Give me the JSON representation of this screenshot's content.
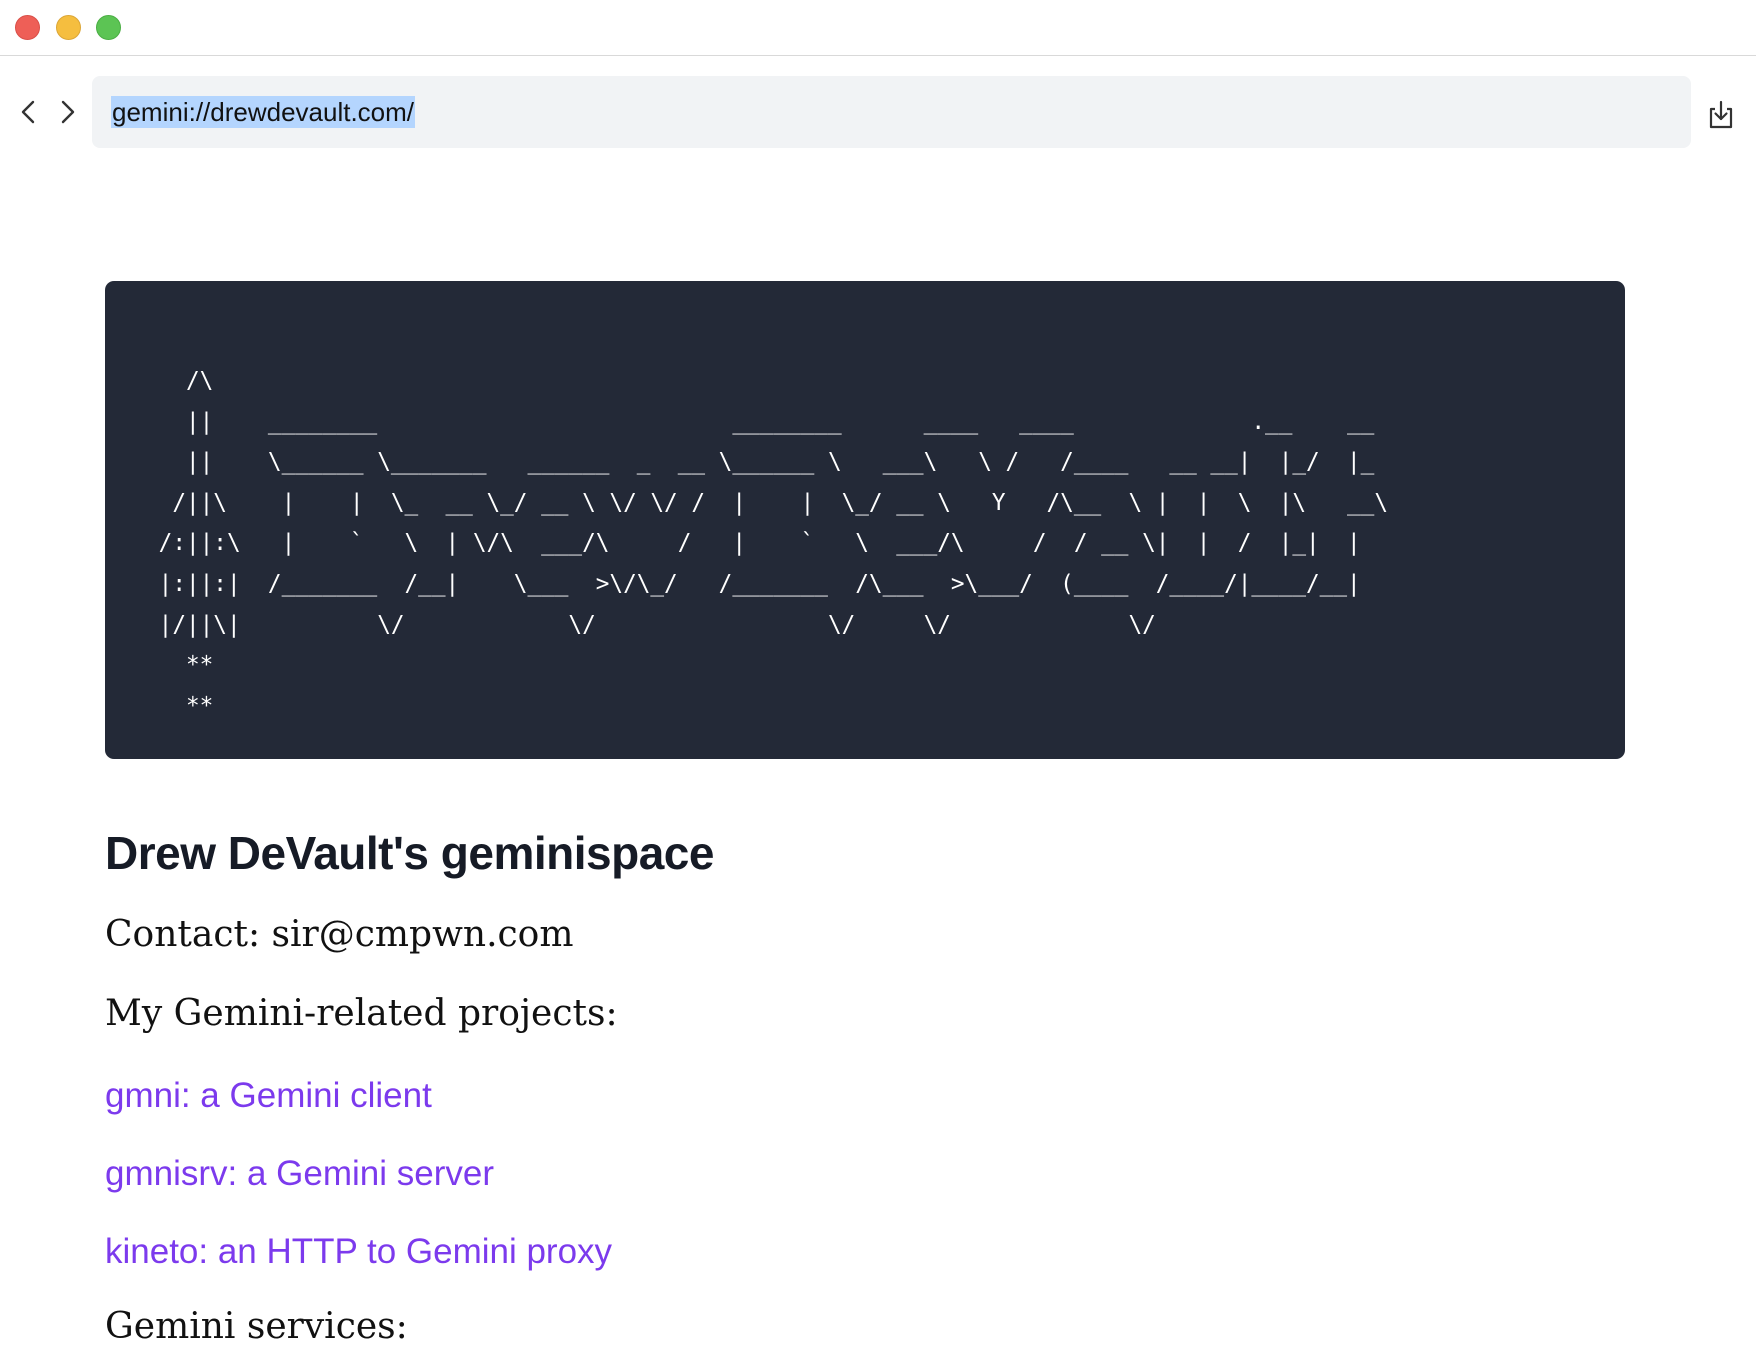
{
  "browser": {
    "url": "gemini://drewdevault.com/",
    "back_icon": "chevron-left-icon",
    "forward_icon": "chevron-right-icon",
    "download_icon": "download-tray-icon"
  },
  "page": {
    "ascii_art": "   /\\\n   ||    ________                          ________      ____   ____             .__    __\n   ||    \\______ \\_______   ______  _  __ \\______ \\   ___\\   \\ /   /____   __ __|  |_/  |_\n  /||\\    |    |  \\_  __ \\_/ __ \\ \\/ \\/ /  |    |  \\_/ __ \\   Y   /\\__  \\ |  |  \\  |\\   __\\\n /:||:\\   |    `   \\  | \\/\\  ___/\\     /   |    `   \\  ___/\\     /  / __ \\|  |  /  |_|  |\n |:||:|  /_______  /__|    \\___  >\\/\\_/   /_______  /\\___  >\\___/  (____  /____/|____/__|\n |/||\\|          \\/            \\/                 \\/     \\/             \\/\n   **\n   **",
    "title": "Drew DeVault's geminispace",
    "contact": "Contact: sir@cmpwn.com",
    "projects_heading": "My Gemini-related projects:",
    "links": [
      "gmni: a Gemini client",
      "gmnisrv: a Gemini server",
      "kineto: an HTTP to Gemini proxy"
    ],
    "services_heading": "Gemini services:"
  },
  "colors": {
    "link": "#7c3aed",
    "code_background": "#232937",
    "url_selection": "#b4d5fe"
  }
}
